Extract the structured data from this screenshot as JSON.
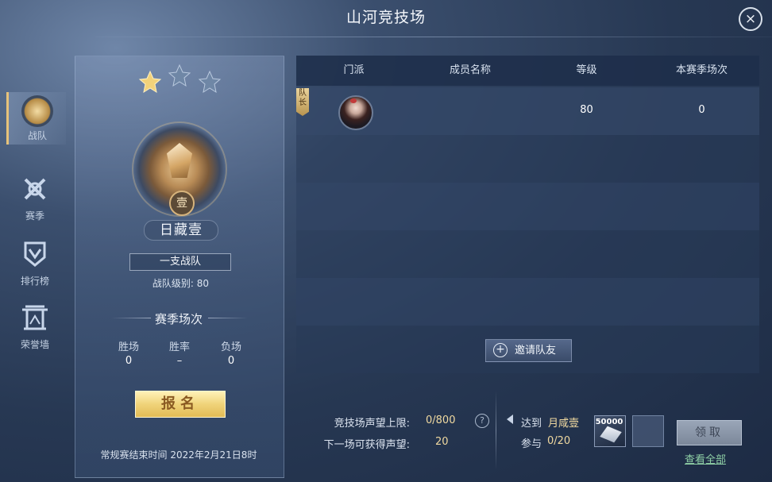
{
  "header": {
    "title": "山河竞技场",
    "close_icon": "×"
  },
  "nav": [
    {
      "label": "战队",
      "icon": "team-icon",
      "active": true
    },
    {
      "label": "赛季",
      "icon": "season-icon",
      "active": false
    },
    {
      "label": "排行榜",
      "icon": "leaderboard-icon",
      "active": false
    },
    {
      "label": "荣誉墙",
      "icon": "honor-wall-icon",
      "active": false
    }
  ],
  "team": {
    "stars_filled": 1,
    "stars_total": 3,
    "rank_badge": "壹",
    "rank_name": "日藏壹",
    "name": "一支战队",
    "level": "战队级别: 80"
  },
  "season": {
    "title": "赛季场次",
    "stats": [
      {
        "label": "胜场",
        "value": "0"
      },
      {
        "label": "胜率",
        "value": "–"
      },
      {
        "label": "负场",
        "value": "0"
      }
    ]
  },
  "signup_label": "报名",
  "end_time": "常规赛结束时间  2022年2月21日8时",
  "table": {
    "headers": [
      "门派",
      "成员名称",
      "等级",
      "本赛季场次"
    ],
    "rows": [
      {
        "captain_tag": "队长",
        "name": "",
        "level": "80",
        "matches": "0"
      }
    ]
  },
  "invite_label": "邀请队友",
  "reputation": {
    "cap_label": "竞技场声望上限:",
    "cap_value": "0/800",
    "next_label": "下一场可获得声望:",
    "next_value": "20"
  },
  "reward": {
    "reach_label": "达到",
    "reach_value": "月咸壹",
    "participate_label": "参与",
    "participate_value": "0/20",
    "item_count": "50000",
    "claim_label": "领取",
    "view_all": "查看全部"
  },
  "colors": {
    "accent_gold": "#e6c27a",
    "link_green": "#8fd0a6",
    "button_yellow": "#f0d37a"
  }
}
